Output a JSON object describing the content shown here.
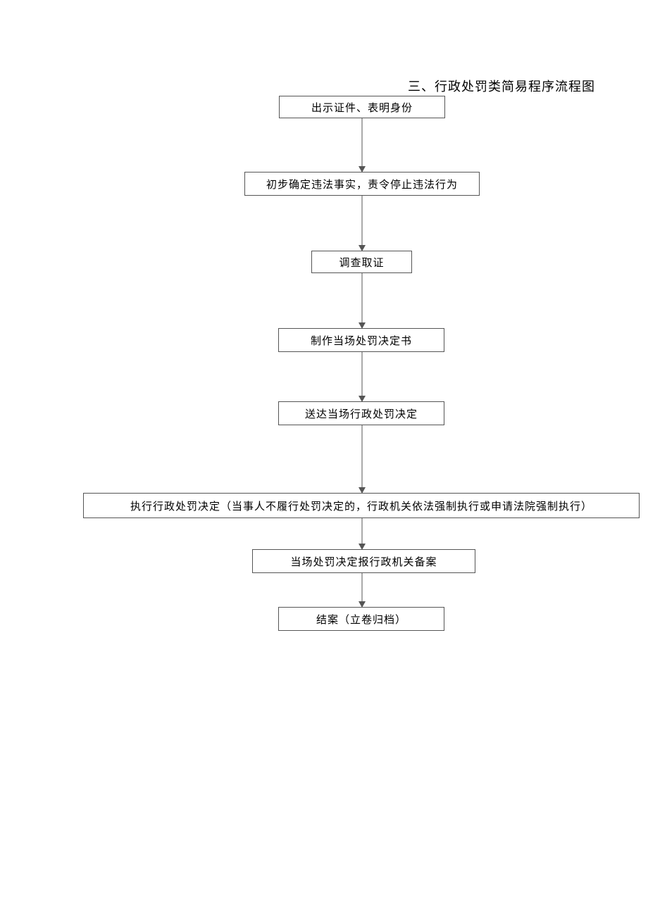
{
  "title": "三、行政处罚类简易程序流程图",
  "chart_data": {
    "type": "flowchart",
    "direction": "top-to-bottom",
    "nodes": [
      {
        "id": "n1",
        "label": "出示证件、表明身份"
      },
      {
        "id": "n2",
        "label": "初步确定违法事实，责令停止违法行为"
      },
      {
        "id": "n3",
        "label": "调查取证"
      },
      {
        "id": "n4",
        "label": "制作当场处罚决定书"
      },
      {
        "id": "n5",
        "label": "送达当场行政处罚决定"
      },
      {
        "id": "n6",
        "label": "执行行政处罚决定（当事人不履行处罚决定的，行政机关依法强制执行或申请法院强制执行）"
      },
      {
        "id": "n7",
        "label": "当场处罚决定报行政机关备案"
      },
      {
        "id": "n8",
        "label": "结案（立卷归档）"
      }
    ],
    "edges": [
      {
        "from": "n1",
        "to": "n2"
      },
      {
        "from": "n2",
        "to": "n3"
      },
      {
        "from": "n3",
        "to": "n4"
      },
      {
        "from": "n4",
        "to": "n5"
      },
      {
        "from": "n5",
        "to": "n6"
      },
      {
        "from": "n6",
        "to": "n7"
      },
      {
        "from": "n7",
        "to": "n8"
      }
    ]
  }
}
